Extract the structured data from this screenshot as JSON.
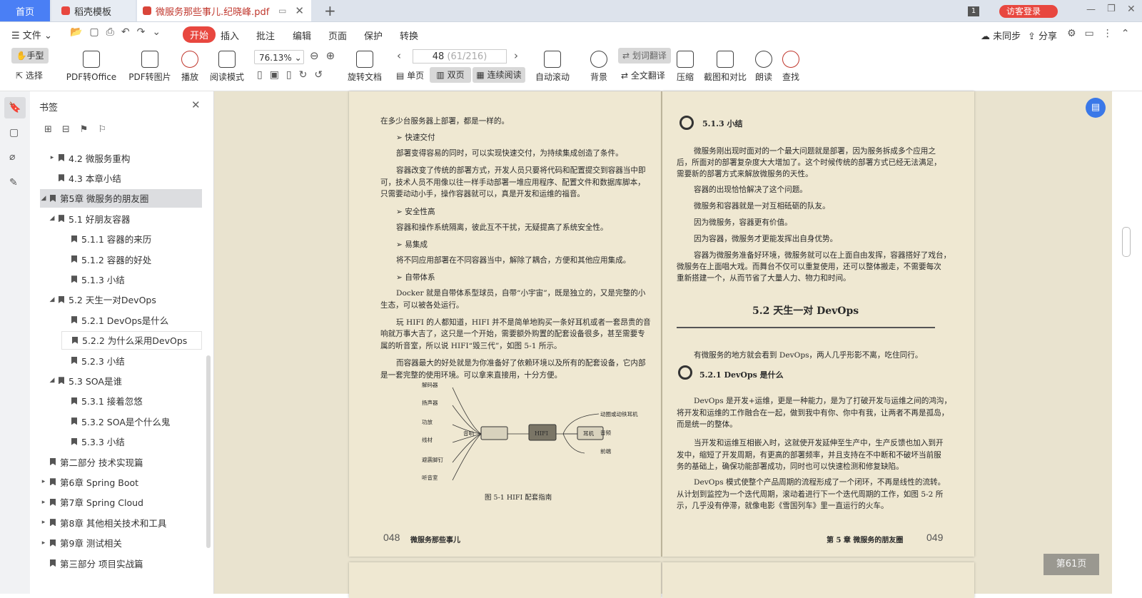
{
  "tabs": {
    "home": "首页",
    "template": "稻壳模板",
    "document": "微服务那些事儿.纪晓峰.pdf",
    "new_tab": "+"
  },
  "titlebar": {
    "badge": "1",
    "login": "访客登录"
  },
  "menu": {
    "file": "文件",
    "start": "开始",
    "items": [
      "插入",
      "批注",
      "编辑",
      "页面",
      "保护",
      "转换"
    ],
    "unsynced": "未同步",
    "share": "分享"
  },
  "toolbar": {
    "hand": "手型",
    "select": "选择",
    "pdf_to_office": "PDF转Office",
    "pdf_to_image": "PDF转图片",
    "play": "播放",
    "read_mode": "阅读模式",
    "zoom": "76.13%",
    "page_num": "48",
    "page_info": "(61/216)",
    "rotate": "旋转文档",
    "single": "单页",
    "double": "双页",
    "continuous": "连续阅读",
    "auto_scroll": "自动滚动",
    "background": "背景",
    "word_translate": "划词翻译",
    "full_translate": "全文翻译",
    "compress": "压缩",
    "screenshot_compare": "截图和对比",
    "read_aloud": "朗读",
    "find": "查找"
  },
  "sidebar": {
    "title": "书签",
    "items": [
      {
        "label": "4.2 微服务重构",
        "level": 1,
        "arrow": "▸"
      },
      {
        "label": "4.3 本章小结",
        "level": 1,
        "arrow": ""
      },
      {
        "label": "第5章 微服务的朋友圈",
        "level": 0,
        "arrow": "◢",
        "selected": true
      },
      {
        "label": "5.1 好朋友容器",
        "level": 1,
        "arrow": "◢"
      },
      {
        "label": "5.1.1 容器的来历",
        "level": 2,
        "arrow": ""
      },
      {
        "label": "5.1.2 容器的好处",
        "level": 2,
        "arrow": ""
      },
      {
        "label": "5.1.3 小结",
        "level": 2,
        "arrow": ""
      },
      {
        "label": "5.2 天生一对DevOps",
        "level": 1,
        "arrow": "◢"
      },
      {
        "label": "5.2.1 DevOps是什么",
        "level": 2,
        "arrow": ""
      },
      {
        "label": "5.2.2 为什么采用DevOps",
        "level": 2,
        "arrow": "",
        "hover": true
      },
      {
        "label": "5.2.3 小结",
        "level": 2,
        "arrow": ""
      },
      {
        "label": "5.3 SOA是谁",
        "level": 1,
        "arrow": "◢"
      },
      {
        "label": "5.3.1 接着忽悠",
        "level": 2,
        "arrow": ""
      },
      {
        "label": "5.3.2 SOA是个什么鬼",
        "level": 2,
        "arrow": ""
      },
      {
        "label": "5.3.3 小结",
        "level": 2,
        "arrow": ""
      },
      {
        "label": "第二部分 技术实现篇",
        "level": 0,
        "arrow": ""
      },
      {
        "label": "第6章 Spring Boot",
        "level": 0,
        "arrow": "▸"
      },
      {
        "label": "第7章 Spring Cloud",
        "level": 0,
        "arrow": "▸"
      },
      {
        "label": "第8章 其他相关技术和工具",
        "level": 0,
        "arrow": "▸"
      },
      {
        "label": "第9章 测试相关",
        "level": 0,
        "arrow": "▸"
      },
      {
        "label": "第三部分 项目实战篇",
        "level": 0,
        "arrow": ""
      }
    ]
  },
  "left_page": {
    "lines": [
      "在多少台服务器上部署，都是一样的。",
      "➢  快速交付",
      "部署变得容易的同时，可以实现快速交付，为持续集成创造了条件。",
      "容器改变了传统的部署方式，开发人员只要将代码和配置提交到容器当中即",
      "可，技术人员不用像以往一样手动部署一堆应用程序、配置文件和数据库脚本，",
      "只需要动动小手，操作容器就可以，真是开发和运维的福音。",
      "➢  安全性高",
      "容器和操作系统隔离，彼此互不干扰，无疑提高了系统安全性。",
      "➢  易集成",
      "将不同应用部署在不同容器当中，解除了耦合，方便和其他应用集成。",
      "➢  自带体系",
      "Docker 就是自带体系型球员，自带“小宇宙”，既是独立的，又是完整的小",
      "生态，可以被各处运行。",
      "玩 HIFI 的人都知道，HIFI 并不是简单地购买一条好耳机或者一套昂贵的音",
      "响就万事大吉了，这只是一个开始，需要额外购置的配套设备很多，甚至需要专",
      "属的听音室，所以说 HIFI“毁三代”，如图 5-1 所示。",
      "而容器最大的好处就是为你准备好了依赖环境以及所有的配套设备，它内部",
      "是一套完整的使用环境。可以拿来直接用，十分方便。"
    ],
    "diagram": {
      "center": "HIFI",
      "left": "音响",
      "right": "耳机",
      "left_items": [
        "解码器",
        "扬声器",
        "功放",
        "线材",
        "避震脚钉",
        "听音室"
      ],
      "right_items": [
        "动圈或动铁耳机",
        "音频",
        "前端"
      ]
    },
    "caption": "图 5-1   HIFI 配套指南",
    "page_no": "048",
    "running": "微服务那些事儿"
  },
  "right_page": {
    "h_513": "5.1.3   小结",
    "para": [
      "微服务刚出现时面对的一个最大问题就是部署，因为服务拆成多个应用之",
      "后，所面对的部署复杂度大大增加了。这个时候传统的部署方式已经无法满足，",
      "需要新的部署方式来解放微服务的天性。",
      "容器的出现恰恰解决了这个问题。",
      "微服务和容器就是一对互相砥砺的队友。",
      "因为微服务，容器更有价值。",
      "因为容器，微服务才更能发挥出自身优势。",
      "容器为微服务准备好环境，微服务就可以在上面自由发挥，容器搭好了戏台，",
      "微服务在上面唱大戏。而舞台不仅可以重复使用，还可以整体搬走，不需要每次",
      "重新搭建一个，从而节省了大量人力、物力和时间。"
    ],
    "h_52": "5.2   天生一对 DevOps",
    "intro": "有微服务的地方就会看到 DevOps，两人几乎形影不离，吃住同行。",
    "h_521": "5.2.1   DevOps 是什么",
    "para2": [
      "DevOps 是开发+运维，更是一种能力，是为了打破开发与运维之间的鸿沟，",
      "将开发和运维的工作融合在一起，做到我中有你、你中有我，让两者不再是孤岛，",
      "而是统一的整体。",
      "当开发和运维互相嵌入时，这就使开发延伸至生产中，生产反馈也加入到开",
      "发中，缩短了开发周期，有更高的部署频率，并且支持在不中断和不破坏当前服",
      "务的基础上，确保功能部署成功，同时也可以快速检测和修复缺陷。",
      "DevOps 模式使整个产品周期的流程形成了一个闭环，不再是线性的流转。",
      "从计划到监控为一个迭代周期，滚动着进行下一个迭代周期的工作，如图 5-2 所",
      "示，几乎没有停滞，就像电影《雪国列车》里一直运行的火车。"
    ],
    "running": "第 5 章   微服务的朋友圈",
    "page_no": "049"
  },
  "page_badge": "第61页",
  "colors": {
    "accent": "#4a7ff5",
    "red": "#e8473f",
    "paper": "#efe8d2",
    "bg": "#e9e3cf"
  }
}
